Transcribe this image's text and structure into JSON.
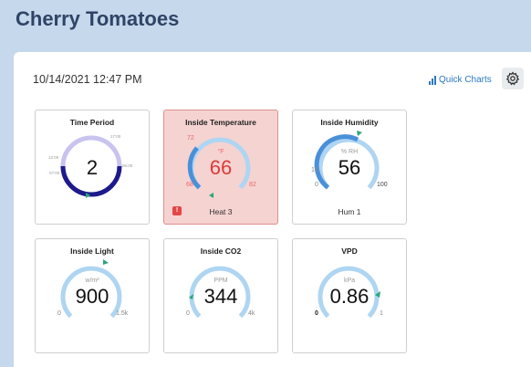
{
  "page_title": "Cherry Tomatoes",
  "timestamp": "10/14/2021 12:47 PM",
  "quick_charts": {
    "label": "Quick Charts",
    "icon": "bar-chart-icon"
  },
  "settings": {
    "icon": "gear-icon"
  },
  "colors": {
    "accent": "#2b78c2",
    "gauge_light": "#aed5f2",
    "gauge_dark": "#1f2d8c",
    "alert": "#e34747"
  },
  "cards": {
    "time_period": {
      "title": "Time Period",
      "value": "2",
      "labels": [
        "12:00",
        "17:00",
        "06:00",
        "07:00"
      ]
    },
    "inside_temperature": {
      "title": "Inside Temperature",
      "unit": "°F",
      "value": "66",
      "min": "68",
      "max": "82",
      "setpoint": "72",
      "status": "Heat 3",
      "alert_icon": "alert-icon",
      "alert_glyph": "!"
    },
    "inside_humidity": {
      "title": "Inside Humidity",
      "unit": "% RH",
      "value": "56",
      "min": "0",
      "max": "100",
      "setpoint": "10",
      "status": "Hum 1"
    },
    "inside_light": {
      "title": "Inside Light",
      "unit": "w/m²",
      "value": "900",
      "min": "0",
      "max": "1.5k"
    },
    "inside_co2": {
      "title": "Inside CO2",
      "unit": "PPM",
      "value": "344",
      "min": "0",
      "max": "4k"
    },
    "vpd": {
      "title": "VPD",
      "unit": "kPa",
      "value": "0.86",
      "min": "0",
      "max": "1"
    }
  }
}
